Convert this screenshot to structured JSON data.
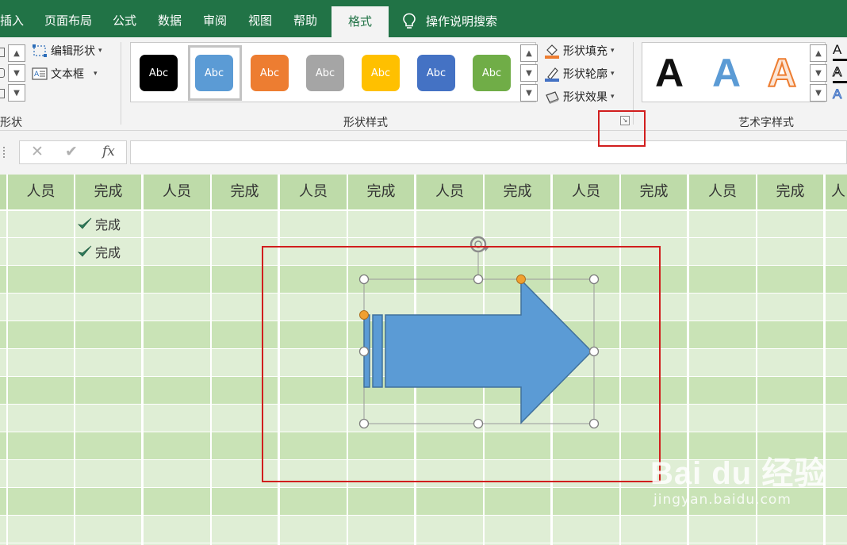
{
  "tabs": [
    {
      "label": "插入",
      "active": false
    },
    {
      "label": "页面布局",
      "active": false
    },
    {
      "label": "公式",
      "active": false
    },
    {
      "label": "数据",
      "active": false
    },
    {
      "label": "审阅",
      "active": false
    },
    {
      "label": "视图",
      "active": false
    },
    {
      "label": "帮助",
      "active": false
    },
    {
      "label": "格式",
      "active": true
    }
  ],
  "tell_me": {
    "label": "操作说明搜索",
    "icon": "lightbulb-icon"
  },
  "ribbon": {
    "insert_shapes": {
      "label": "形状",
      "edit_shape": "编辑形状",
      "text_box": "文本框"
    },
    "shape_styles": {
      "label": "形状样式",
      "gallery": [
        {
          "text": "Abc",
          "color": "#000000"
        },
        {
          "text": "Abc",
          "color": "#5b9bd5",
          "selected": true
        },
        {
          "text": "Abc",
          "color": "#ed7d31"
        },
        {
          "text": "Abc",
          "color": "#a5a5a5"
        },
        {
          "text": "Abc",
          "color": "#ffc000"
        },
        {
          "text": "Abc",
          "color": "#4472c4"
        },
        {
          "text": "Abc",
          "color": "#70ad47"
        }
      ],
      "fill": "形状填充",
      "outline": "形状轮廓",
      "effects": "形状效果",
      "dialog_launcher_icon": "dialog-launcher-icon"
    },
    "wordart_styles": {
      "label": "艺术字样式",
      "gallery": [
        {
          "text": "A",
          "style": "black-fill"
        },
        {
          "text": "A",
          "style": "blue-gradient"
        },
        {
          "text": "A",
          "style": "orange-outline"
        }
      ]
    }
  },
  "formula_bar": {
    "cancel_icon": "✕",
    "enter_icon": "✔",
    "fx_label": "fx",
    "value": ""
  },
  "sheet": {
    "headers": [
      "人员",
      "完成",
      "人员",
      "完成",
      "人员",
      "完成",
      "人员",
      "完成",
      "人员",
      "完成",
      "人员",
      "完成",
      "人"
    ],
    "rows": [
      {
        "done_text": "完成"
      },
      {
        "done_text": "完成"
      }
    ]
  },
  "shape": {
    "type": "striped-right-arrow",
    "fill": "#5b9bd5",
    "outline": "#41719c"
  },
  "watermark": {
    "brand": "Bai du 经验",
    "url": "jingyan.baidu.com"
  },
  "colors": {
    "accent": "#217346",
    "highlight": "#d11e1e"
  }
}
